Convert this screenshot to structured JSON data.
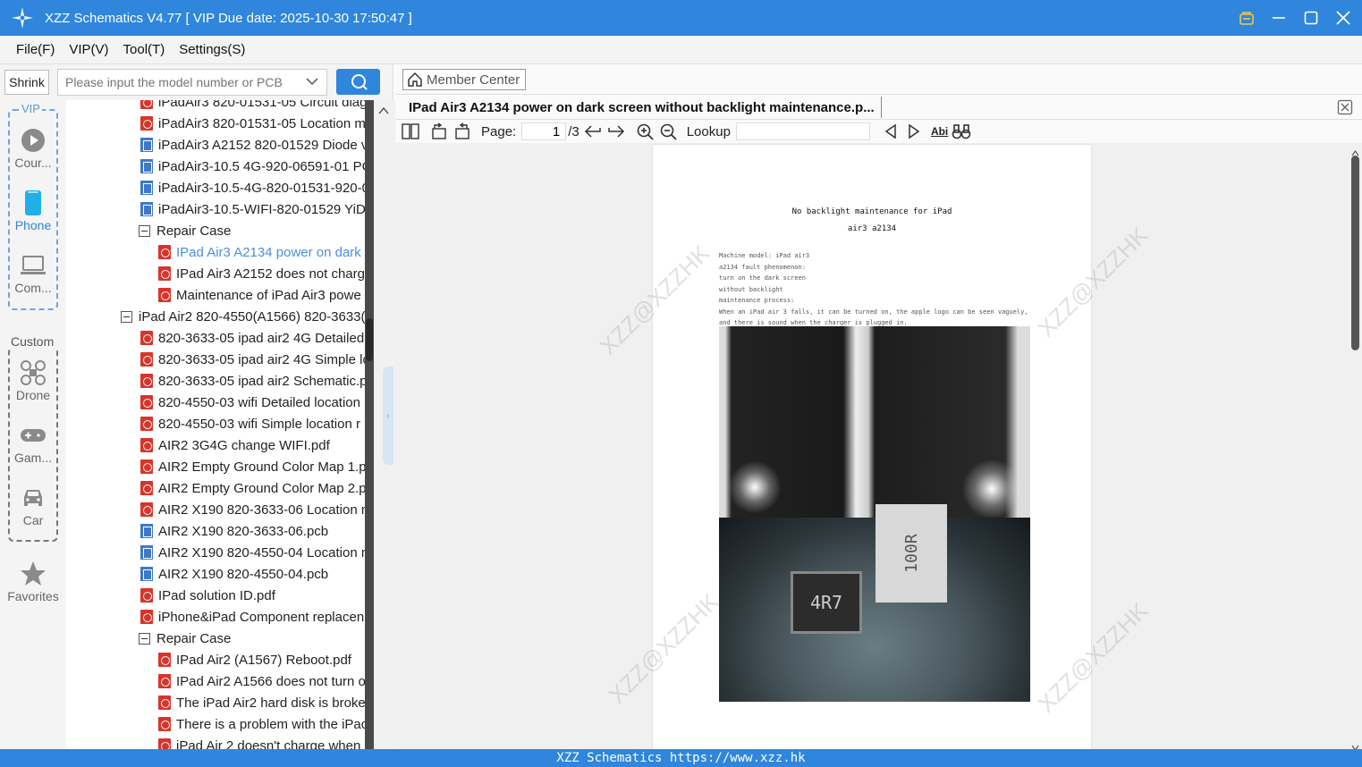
{
  "window": {
    "title": "XZZ Schematics V4.77 [ VIP Due date: 2025-10-30 17:50:47 ]"
  },
  "menu": {
    "items": [
      "File(F)",
      "VIP(V)",
      "Tool(T)",
      "Settings(S)"
    ]
  },
  "search": {
    "shrink_label": "Shrink",
    "placeholder": "Please input the model number or PCB"
  },
  "rail": {
    "vip_label": "VIP",
    "custom_label": "Custom",
    "vip_items": [
      "Cour...",
      "Phone",
      "Com..."
    ],
    "custom_items": [
      "Drone",
      "Gam...",
      "Car"
    ],
    "favorites": "Favorites"
  },
  "tree": {
    "rows": [
      {
        "type": "pdf",
        "indent": 1,
        "label": "iPadAir3 820-01531-05 Circuit diag"
      },
      {
        "type": "pdf",
        "indent": 1,
        "label": "iPadAir3 820-01531-05 Location m"
      },
      {
        "type": "pcb",
        "indent": 1,
        "label": "iPadAir3 A2152 820-01529 Diode v"
      },
      {
        "type": "pcb",
        "indent": 1,
        "label": "iPadAir3-10.5 4G-920-06591-01 PC"
      },
      {
        "type": "pcb",
        "indent": 1,
        "label": "iPadAir3-10.5-4G-820-01531-920-0"
      },
      {
        "type": "pcb",
        "indent": 1,
        "label": "iPadAir3-10.5-WIFI-820-01529 YiDi"
      },
      {
        "type": "folder",
        "indent": 1,
        "label": "Repair Case"
      },
      {
        "type": "pdf",
        "indent": 2,
        "label": "IPad Air3 A2134 power on dark",
        "active": true
      },
      {
        "type": "pdf",
        "indent": 2,
        "label": "IPad Air3 A2152 does not charg"
      },
      {
        "type": "pdf",
        "indent": 2,
        "label": "Maintenance of iPad Air3 powe"
      },
      {
        "type": "folder",
        "indent": 0,
        "label": "iPad Air2 820-4550(A1566) 820-3633("
      },
      {
        "type": "pdf",
        "indent": 1,
        "label": "820-3633-05 ipad air2 4G Detailed"
      },
      {
        "type": "pdf",
        "indent": 1,
        "label": "820-3633-05 ipad air2 4G Simple lo"
      },
      {
        "type": "pdf",
        "indent": 1,
        "label": "820-3633-05 ipad air2 Schematic.p"
      },
      {
        "type": "pdf",
        "indent": 1,
        "label": "820-4550-03 wifi Detailed location"
      },
      {
        "type": "pdf",
        "indent": 1,
        "label": "820-4550-03 wifi Simple location r"
      },
      {
        "type": "pdf",
        "indent": 1,
        "label": "AIR2 3G4G change WIFI.pdf"
      },
      {
        "type": "pdf",
        "indent": 1,
        "label": "AIR2 Empty Ground Color Map 1.p"
      },
      {
        "type": "pdf",
        "indent": 1,
        "label": "AIR2 Empty Ground Color Map 2.p"
      },
      {
        "type": "pdf",
        "indent": 1,
        "label": "AIR2 X190 820-3633-06 Location m"
      },
      {
        "type": "pcb",
        "indent": 1,
        "label": "AIR2 X190 820-3633-06.pcb"
      },
      {
        "type": "pcb",
        "indent": 1,
        "label": "AIR2 X190 820-4550-04 Location m"
      },
      {
        "type": "pcb",
        "indent": 1,
        "label": "AIR2 X190 820-4550-04.pcb"
      },
      {
        "type": "pdf",
        "indent": 1,
        "label": "IPad solution ID.pdf"
      },
      {
        "type": "pdf",
        "indent": 1,
        "label": "iPhone&iPad Component replacen"
      },
      {
        "type": "folder",
        "indent": 1,
        "label": "Repair Case"
      },
      {
        "type": "pdf",
        "indent": 2,
        "label": "IPad Air2 (A1567) Reboot.pdf"
      },
      {
        "type": "pdf",
        "indent": 2,
        "label": "IPad Air2 A1566 does not turn o"
      },
      {
        "type": "pdf",
        "indent": 2,
        "label": "The iPad Air2 hard disk is broke"
      },
      {
        "type": "pdf",
        "indent": 2,
        "label": "There is a problem with the iPac"
      },
      {
        "type": "pdf",
        "indent": 2,
        "label": "iPad Air 2 doesn't charge when"
      }
    ]
  },
  "viewer": {
    "member_center": "Member Center",
    "doc_title": "IPad Air3 A2134 power on dark screen without backlight maintenance.p...",
    "page_label": "Page:",
    "page_value": "1",
    "page_total": "/3",
    "lookup_label": "Lookup",
    "abi_label": "Abi"
  },
  "document": {
    "heading1": "No backlight maintenance for iPad",
    "heading2": "air3 a2134",
    "lines": [
      "Machine model: iPad air3",
      "a2134 fault phenomenon:",
      "turn on the dark screen",
      "without backlight",
      "maintenance process:",
      "When an iPad air 3 falls, it can be turned on, the apple logo can be seen vaguely,",
      "and there is sound when the charger is plugged in."
    ],
    "chip_text": "4R7",
    "coil_text": "100R"
  },
  "status": {
    "text": "XZZ Schematics https://www.xzz.hk"
  },
  "colors": {
    "accent": "#2f86dc",
    "pdf_icon": "#d9342b",
    "pcb_icon": "#3f78c8",
    "active_link": "#4b8fde"
  }
}
